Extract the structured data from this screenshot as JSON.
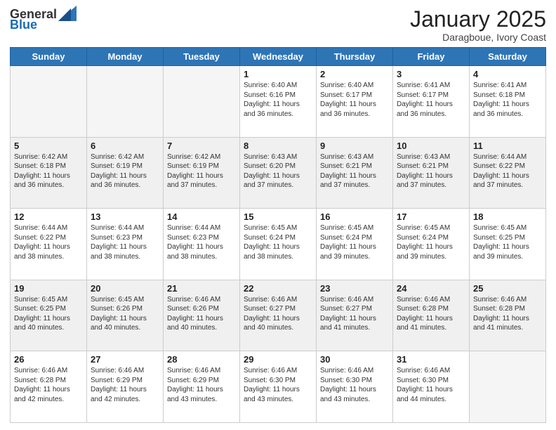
{
  "header": {
    "logo_general": "General",
    "logo_blue": "Blue",
    "month_title": "January 2025",
    "location": "Daragboue, Ivory Coast"
  },
  "weekdays": [
    "Sunday",
    "Monday",
    "Tuesday",
    "Wednesday",
    "Thursday",
    "Friday",
    "Saturday"
  ],
  "weeks": [
    [
      {
        "day": "",
        "sunrise": "",
        "sunset": "",
        "daylight": "",
        "empty": true
      },
      {
        "day": "",
        "sunrise": "",
        "sunset": "",
        "daylight": "",
        "empty": true
      },
      {
        "day": "",
        "sunrise": "",
        "sunset": "",
        "daylight": "",
        "empty": true
      },
      {
        "day": "1",
        "sunrise": "Sunrise: 6:40 AM",
        "sunset": "Sunset: 6:16 PM",
        "daylight": "Daylight: 11 hours and 36 minutes.",
        "empty": false
      },
      {
        "day": "2",
        "sunrise": "Sunrise: 6:40 AM",
        "sunset": "Sunset: 6:17 PM",
        "daylight": "Daylight: 11 hours and 36 minutes.",
        "empty": false
      },
      {
        "day": "3",
        "sunrise": "Sunrise: 6:41 AM",
        "sunset": "Sunset: 6:17 PM",
        "daylight": "Daylight: 11 hours and 36 minutes.",
        "empty": false
      },
      {
        "day": "4",
        "sunrise": "Sunrise: 6:41 AM",
        "sunset": "Sunset: 6:18 PM",
        "daylight": "Daylight: 11 hours and 36 minutes.",
        "empty": false
      }
    ],
    [
      {
        "day": "5",
        "sunrise": "Sunrise: 6:42 AM",
        "sunset": "Sunset: 6:18 PM",
        "daylight": "Daylight: 11 hours and 36 minutes.",
        "empty": false
      },
      {
        "day": "6",
        "sunrise": "Sunrise: 6:42 AM",
        "sunset": "Sunset: 6:19 PM",
        "daylight": "Daylight: 11 hours and 36 minutes.",
        "empty": false
      },
      {
        "day": "7",
        "sunrise": "Sunrise: 6:42 AM",
        "sunset": "Sunset: 6:19 PM",
        "daylight": "Daylight: 11 hours and 37 minutes.",
        "empty": false
      },
      {
        "day": "8",
        "sunrise": "Sunrise: 6:43 AM",
        "sunset": "Sunset: 6:20 PM",
        "daylight": "Daylight: 11 hours and 37 minutes.",
        "empty": false
      },
      {
        "day": "9",
        "sunrise": "Sunrise: 6:43 AM",
        "sunset": "Sunset: 6:21 PM",
        "daylight": "Daylight: 11 hours and 37 minutes.",
        "empty": false
      },
      {
        "day": "10",
        "sunrise": "Sunrise: 6:43 AM",
        "sunset": "Sunset: 6:21 PM",
        "daylight": "Daylight: 11 hours and 37 minutes.",
        "empty": false
      },
      {
        "day": "11",
        "sunrise": "Sunrise: 6:44 AM",
        "sunset": "Sunset: 6:22 PM",
        "daylight": "Daylight: 11 hours and 37 minutes.",
        "empty": false
      }
    ],
    [
      {
        "day": "12",
        "sunrise": "Sunrise: 6:44 AM",
        "sunset": "Sunset: 6:22 PM",
        "daylight": "Daylight: 11 hours and 38 minutes.",
        "empty": false
      },
      {
        "day": "13",
        "sunrise": "Sunrise: 6:44 AM",
        "sunset": "Sunset: 6:23 PM",
        "daylight": "Daylight: 11 hours and 38 minutes.",
        "empty": false
      },
      {
        "day": "14",
        "sunrise": "Sunrise: 6:44 AM",
        "sunset": "Sunset: 6:23 PM",
        "daylight": "Daylight: 11 hours and 38 minutes.",
        "empty": false
      },
      {
        "day": "15",
        "sunrise": "Sunrise: 6:45 AM",
        "sunset": "Sunset: 6:24 PM",
        "daylight": "Daylight: 11 hours and 38 minutes.",
        "empty": false
      },
      {
        "day": "16",
        "sunrise": "Sunrise: 6:45 AM",
        "sunset": "Sunset: 6:24 PM",
        "daylight": "Daylight: 11 hours and 39 minutes.",
        "empty": false
      },
      {
        "day": "17",
        "sunrise": "Sunrise: 6:45 AM",
        "sunset": "Sunset: 6:24 PM",
        "daylight": "Daylight: 11 hours and 39 minutes.",
        "empty": false
      },
      {
        "day": "18",
        "sunrise": "Sunrise: 6:45 AM",
        "sunset": "Sunset: 6:25 PM",
        "daylight": "Daylight: 11 hours and 39 minutes.",
        "empty": false
      }
    ],
    [
      {
        "day": "19",
        "sunrise": "Sunrise: 6:45 AM",
        "sunset": "Sunset: 6:25 PM",
        "daylight": "Daylight: 11 hours and 40 minutes.",
        "empty": false
      },
      {
        "day": "20",
        "sunrise": "Sunrise: 6:45 AM",
        "sunset": "Sunset: 6:26 PM",
        "daylight": "Daylight: 11 hours and 40 minutes.",
        "empty": false
      },
      {
        "day": "21",
        "sunrise": "Sunrise: 6:46 AM",
        "sunset": "Sunset: 6:26 PM",
        "daylight": "Daylight: 11 hours and 40 minutes.",
        "empty": false
      },
      {
        "day": "22",
        "sunrise": "Sunrise: 6:46 AM",
        "sunset": "Sunset: 6:27 PM",
        "daylight": "Daylight: 11 hours and 40 minutes.",
        "empty": false
      },
      {
        "day": "23",
        "sunrise": "Sunrise: 6:46 AM",
        "sunset": "Sunset: 6:27 PM",
        "daylight": "Daylight: 11 hours and 41 minutes.",
        "empty": false
      },
      {
        "day": "24",
        "sunrise": "Sunrise: 6:46 AM",
        "sunset": "Sunset: 6:28 PM",
        "daylight": "Daylight: 11 hours and 41 minutes.",
        "empty": false
      },
      {
        "day": "25",
        "sunrise": "Sunrise: 6:46 AM",
        "sunset": "Sunset: 6:28 PM",
        "daylight": "Daylight: 11 hours and 41 minutes.",
        "empty": false
      }
    ],
    [
      {
        "day": "26",
        "sunrise": "Sunrise: 6:46 AM",
        "sunset": "Sunset: 6:28 PM",
        "daylight": "Daylight: 11 hours and 42 minutes.",
        "empty": false
      },
      {
        "day": "27",
        "sunrise": "Sunrise: 6:46 AM",
        "sunset": "Sunset: 6:29 PM",
        "daylight": "Daylight: 11 hours and 42 minutes.",
        "empty": false
      },
      {
        "day": "28",
        "sunrise": "Sunrise: 6:46 AM",
        "sunset": "Sunset: 6:29 PM",
        "daylight": "Daylight: 11 hours and 43 minutes.",
        "empty": false
      },
      {
        "day": "29",
        "sunrise": "Sunrise: 6:46 AM",
        "sunset": "Sunset: 6:30 PM",
        "daylight": "Daylight: 11 hours and 43 minutes.",
        "empty": false
      },
      {
        "day": "30",
        "sunrise": "Sunrise: 6:46 AM",
        "sunset": "Sunset: 6:30 PM",
        "daylight": "Daylight: 11 hours and 43 minutes.",
        "empty": false
      },
      {
        "day": "31",
        "sunrise": "Sunrise: 6:46 AM",
        "sunset": "Sunset: 6:30 PM",
        "daylight": "Daylight: 11 hours and 44 minutes.",
        "empty": false
      },
      {
        "day": "",
        "sunrise": "",
        "sunset": "",
        "daylight": "",
        "empty": true
      }
    ]
  ]
}
